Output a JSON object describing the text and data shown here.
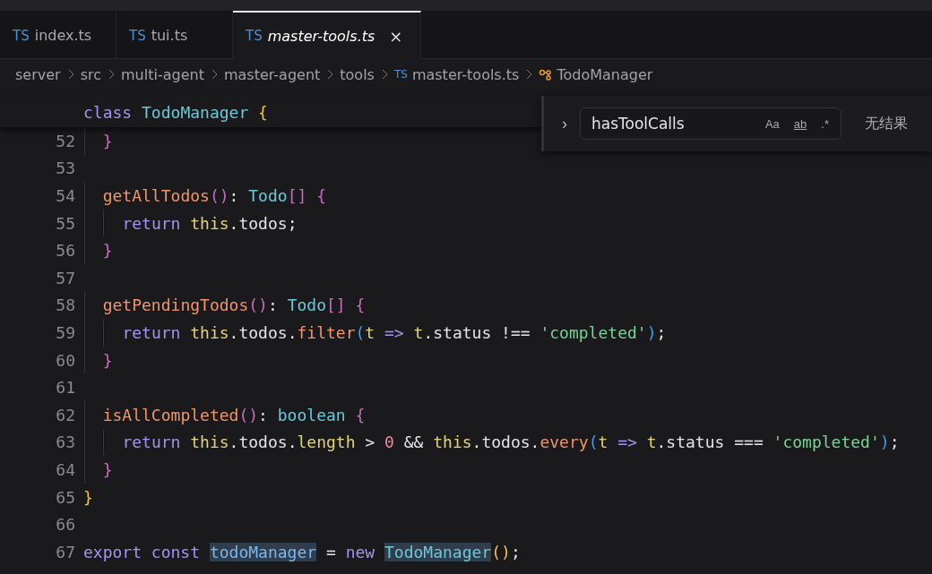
{
  "tabs": [
    {
      "icon": "TS",
      "label": "index.ts",
      "selected": false,
      "preview": false
    },
    {
      "icon": "TS",
      "label": "tui.ts",
      "selected": false,
      "preview": false
    },
    {
      "icon": "TS",
      "label": "master-tools.ts",
      "selected": true,
      "preview": true,
      "close": "×"
    }
  ],
  "breadcrumbs": [
    {
      "label": "server",
      "kind": "folder"
    },
    {
      "label": "src",
      "kind": "folder"
    },
    {
      "label": "multi-agent",
      "kind": "folder"
    },
    {
      "label": "master-agent",
      "kind": "folder"
    },
    {
      "label": "tools",
      "kind": "folder"
    },
    {
      "label": "master-tools.ts",
      "kind": "file",
      "icon": "TS"
    },
    {
      "label": "TodoManager",
      "kind": "class"
    }
  ],
  "sticky_line": [
    {
      "text": "class ",
      "kind": "keyword"
    },
    {
      "text": "TodoManager ",
      "kind": "type"
    },
    {
      "text": "{",
      "kind": "brace1"
    }
  ],
  "lines": [
    {
      "number": "52",
      "kind": "member",
      "tokens": [
        {
          "text": "}",
          "kind": "brace2"
        }
      ]
    },
    {
      "number": "53",
      "kind": "blank"
    },
    {
      "number": "54",
      "kind": "member",
      "tokens": [
        {
          "text": "getAllTodos",
          "kind": "function"
        },
        {
          "text": "()",
          "kind": "brace2"
        },
        {
          "text": ": ",
          "kind": "plain"
        },
        {
          "text": "Todo",
          "kind": "type"
        },
        {
          "text": "[] {",
          "kind": "brace2"
        }
      ]
    },
    {
      "number": "55",
      "kind": "statement",
      "tokens": [
        {
          "text": "return ",
          "kind": "keyword"
        },
        {
          "text": "this",
          "kind": "this"
        },
        {
          "text": ".todos;",
          "kind": "plain"
        }
      ]
    },
    {
      "number": "56",
      "kind": "member",
      "tokens": [
        {
          "text": "}",
          "kind": "brace2"
        }
      ]
    },
    {
      "number": "57",
      "kind": "blank"
    },
    {
      "number": "58",
      "kind": "member",
      "tokens": [
        {
          "text": "getPendingTodos",
          "kind": "function"
        },
        {
          "text": "()",
          "kind": "brace2"
        },
        {
          "text": ": ",
          "kind": "plain"
        },
        {
          "text": "Todo",
          "kind": "type"
        },
        {
          "text": "[] {",
          "kind": "brace2"
        }
      ]
    },
    {
      "number": "59",
      "kind": "statement",
      "tokens": [
        {
          "text": "return ",
          "kind": "keyword"
        },
        {
          "text": "this",
          "kind": "this"
        },
        {
          "text": ".todos.",
          "kind": "plain"
        },
        {
          "text": "filter",
          "kind": "function"
        },
        {
          "text": "(",
          "kind": "brace3"
        },
        {
          "text": "t ",
          "kind": "this"
        },
        {
          "text": "=> ",
          "kind": "keyword"
        },
        {
          "text": "t",
          "kind": "this"
        },
        {
          "text": ".status !== ",
          "kind": "plain"
        },
        {
          "text": "'completed'",
          "kind": "string"
        },
        {
          "text": ")",
          "kind": "brace3"
        },
        {
          "text": ";",
          "kind": "plain"
        }
      ]
    },
    {
      "number": "60",
      "kind": "member",
      "tokens": [
        {
          "text": "}",
          "kind": "brace2"
        }
      ]
    },
    {
      "number": "61",
      "kind": "blank"
    },
    {
      "number": "62",
      "kind": "member",
      "tokens": [
        {
          "text": "isAllCompleted",
          "kind": "function"
        },
        {
          "text": "()",
          "kind": "brace2"
        },
        {
          "text": ": ",
          "kind": "plain"
        },
        {
          "text": "boolean ",
          "kind": "type"
        },
        {
          "text": "{",
          "kind": "brace2"
        }
      ]
    },
    {
      "number": "63",
      "kind": "statement",
      "tokens": [
        {
          "text": "return ",
          "kind": "keyword"
        },
        {
          "text": "this",
          "kind": "this"
        },
        {
          "text": ".todos.",
          "kind": "plain"
        },
        {
          "text": "length",
          "kind": "this"
        },
        {
          "text": " > ",
          "kind": "plain"
        },
        {
          "text": "0",
          "kind": "number"
        },
        {
          "text": " && ",
          "kind": "plain"
        },
        {
          "text": "this",
          "kind": "this"
        },
        {
          "text": ".todos.",
          "kind": "plain"
        },
        {
          "text": "every",
          "kind": "function"
        },
        {
          "text": "(",
          "kind": "brace3"
        },
        {
          "text": "t ",
          "kind": "this"
        },
        {
          "text": "=> ",
          "kind": "keyword"
        },
        {
          "text": "t",
          "kind": "this"
        },
        {
          "text": ".status === ",
          "kind": "plain"
        },
        {
          "text": "'completed'",
          "kind": "string"
        },
        {
          "text": ")",
          "kind": "brace3"
        },
        {
          "text": ";",
          "kind": "plain"
        }
      ]
    },
    {
      "number": "64",
      "kind": "member",
      "tokens": [
        {
          "text": "}",
          "kind": "brace2"
        }
      ]
    },
    {
      "number": "65",
      "kind": "top",
      "tokens": [
        {
          "text": "}",
          "kind": "brace1"
        }
      ]
    },
    {
      "number": "66",
      "kind": "blank"
    },
    {
      "number": "67",
      "kind": "top",
      "tokens": [
        {
          "text": "export const ",
          "kind": "keyword"
        },
        {
          "text": "todoManager",
          "kind": "variable",
          "highlighted": true
        },
        {
          "text": " = ",
          "kind": "plain"
        },
        {
          "text": "new ",
          "kind": "keyword"
        },
        {
          "text": "TodoManager",
          "kind": "type",
          "highlighted": true
        },
        {
          "text": "()",
          "kind": "brace1"
        },
        {
          "text": ";",
          "kind": "plain"
        }
      ]
    }
  ],
  "find_widget": {
    "toggle": "›",
    "value": "hasToolCalls",
    "options": [
      {
        "label": "Aa",
        "kind": "case",
        "on": false
      },
      {
        "label": "ab",
        "kind": "word",
        "on": false
      },
      {
        "label": ".*",
        "kind": "regex",
        "on": false
      }
    ],
    "result": "无结果"
  }
}
